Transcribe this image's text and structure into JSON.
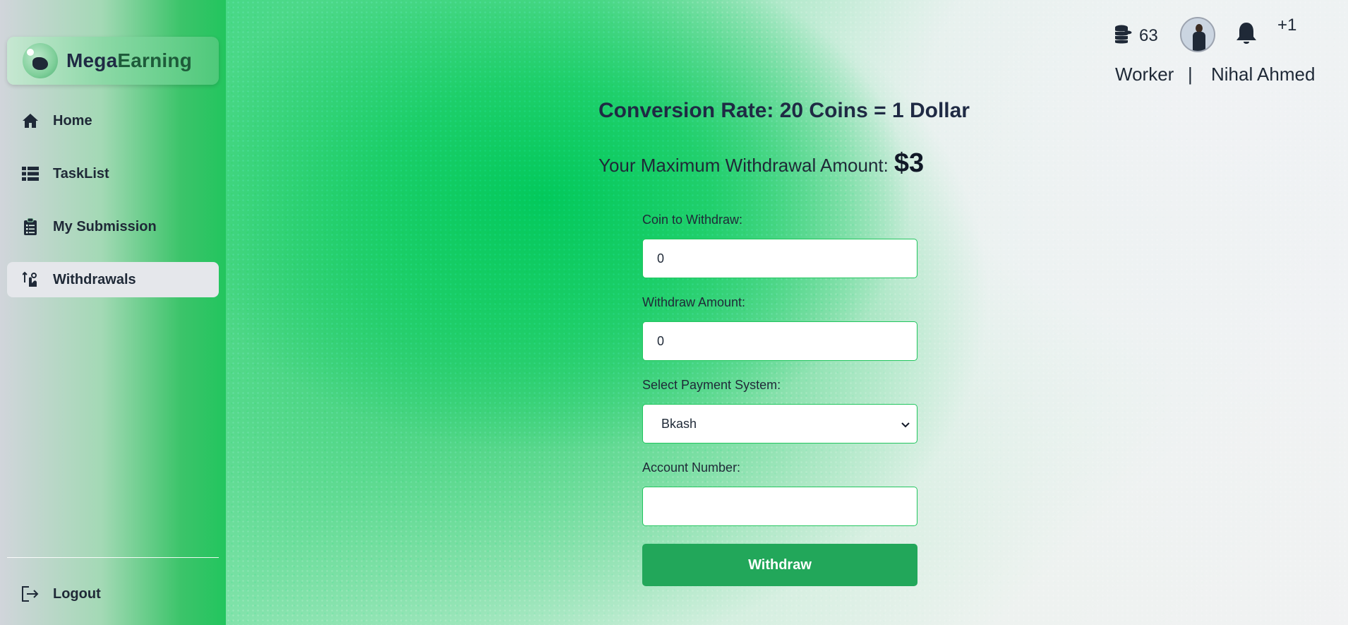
{
  "brand": {
    "part1": "Mega",
    "part2": "Earning"
  },
  "sidebar": {
    "items": [
      {
        "label": "Home",
        "icon": "home-icon"
      },
      {
        "label": "TaskList",
        "icon": "list-icon"
      },
      {
        "label": "My Submission",
        "icon": "clipboard-icon"
      },
      {
        "label": "Withdrawals",
        "icon": "withdraw-icon",
        "active": true
      }
    ],
    "logout": {
      "label": "Logout",
      "icon": "logout-icon"
    }
  },
  "header": {
    "coins": "63",
    "notification_badge": "+1",
    "role": "Worker",
    "separator": "|",
    "user_name": "Nihal Ahmed"
  },
  "content": {
    "conversion_rate": "Conversion Rate: 20 Coins = 1 Dollar",
    "max_withdraw_label": "Your Maximum Withdrawal Amount:",
    "max_withdraw_value": "$3",
    "form": {
      "coin_label": "Coin to Withdraw:",
      "coin_value": "0",
      "amount_label": "Withdraw Amount:",
      "amount_value": "0",
      "payment_label": "Select Payment System:",
      "payment_value": "Bkash",
      "account_label": "Account Number:",
      "account_value": "",
      "submit_label": "Withdraw"
    }
  },
  "colors": {
    "accent": "#22c55e",
    "button": "#22a75a",
    "active_nav": "#e5e7eb"
  }
}
